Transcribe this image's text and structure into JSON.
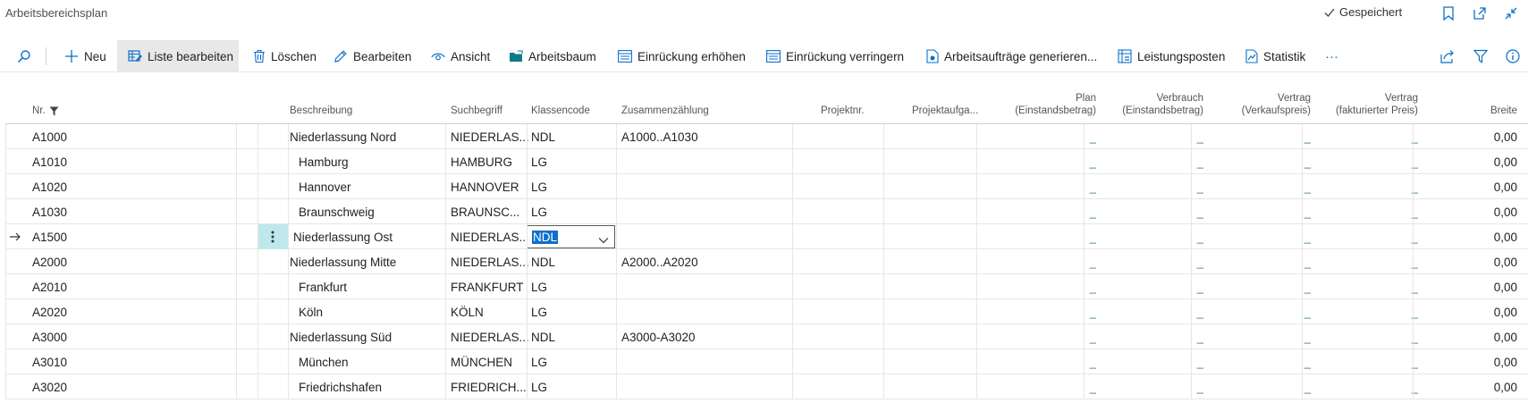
{
  "window": {
    "title": "Arbeitsbereichsplan",
    "saved_label": "Gespeichert"
  },
  "actions": {
    "new": "Neu",
    "edit_list": "Liste bearbeiten",
    "delete": "Löschen",
    "edit": "Bearbeiten",
    "view": "Ansicht",
    "job_tree": "Arbeitsbaum",
    "indent_increase": "Einrückung erhöhen",
    "indent_decrease": "Einrückung verringern",
    "generate_jobs": "Arbeitsaufträge generieren...",
    "ledger_entries": "Leistungsposten",
    "statistics": "Statistik",
    "more": "···"
  },
  "columns": {
    "no": "Nr.",
    "description": "Beschreibung",
    "search_name": "Suchbegriff",
    "class_code": "Klassencode",
    "totaling": "Zusammenzählung",
    "project_no": "Projektnr.",
    "project_task": "Projektaufga...",
    "plan_1": "Plan",
    "plan_2": "(Einstandsbetrag)",
    "usage_1": "Verbrauch",
    "usage_2": "(Einstandsbetrag)",
    "contract_1": "Vertrag",
    "contract_2": "(Verkaufspreis)",
    "invoiced_1": "Vertrag",
    "invoiced_2": "(fakturierter Preis)",
    "width": "Breite"
  },
  "rows": [
    {
      "no": "A1000",
      "description": "Niederlassung Nord",
      "search": "NIEDERLAS...",
      "class": "NDL",
      "totaling": "A1000..A1030",
      "plan": "_",
      "usage": "_",
      "contract": "_",
      "invoiced": "_",
      "width": "0,00"
    },
    {
      "no": "A1010",
      "description": "Hamburg",
      "search": "HAMBURG",
      "class": "LG",
      "totaling": "",
      "plan": "_",
      "usage": "_",
      "contract": "_",
      "invoiced": "_",
      "width": "0,00"
    },
    {
      "no": "A1020",
      "description": "Hannover",
      "search": "HANNOVER",
      "class": "LG",
      "totaling": "",
      "plan": "_",
      "usage": "_",
      "contract": "_",
      "invoiced": "_",
      "width": "0,00"
    },
    {
      "no": "A1030",
      "description": "Braunschweig",
      "search": "BRAUNSC...",
      "class": "LG",
      "totaling": "",
      "plan": "_",
      "usage": "_",
      "contract": "_",
      "invoiced": "_",
      "width": "0,00"
    },
    {
      "no": "A1500",
      "description": "Niederlassung Ost",
      "search": "NIEDERLAS...",
      "class": "NDL",
      "totaling": "",
      "plan": "_",
      "usage": "_",
      "contract": "_",
      "invoiced": "_",
      "width": "0,00"
    },
    {
      "no": "A2000",
      "description": "Niederlassung Mitte",
      "search": "NIEDERLAS...",
      "class": "NDL",
      "totaling": "A2000..A2020",
      "plan": "_",
      "usage": "_",
      "contract": "_",
      "invoiced": "_",
      "width": "0,00"
    },
    {
      "no": "A2010",
      "description": "Frankfurt",
      "search": "FRANKFURT",
      "class": "LG",
      "totaling": "",
      "plan": "_",
      "usage": "_",
      "contract": "_",
      "invoiced": "_",
      "width": "0,00"
    },
    {
      "no": "A2020",
      "description": "Köln",
      "search": "KÖLN",
      "class": "LG",
      "totaling": "",
      "plan": "_",
      "usage": "_",
      "contract": "_",
      "invoiced": "_",
      "width": "0,00"
    },
    {
      "no": "A3000",
      "description": "Niederlassung Süd",
      "search": "NIEDERLAS...",
      "class": "NDL",
      "totaling": "A3000-A3020",
      "plan": "_",
      "usage": "_",
      "contract": "_",
      "invoiced": "_",
      "width": "0,00"
    },
    {
      "no": "A3010",
      "description": "München",
      "search": "MÜNCHEN",
      "class": "LG",
      "totaling": "",
      "plan": "_",
      "usage": "_",
      "contract": "_",
      "invoiced": "_",
      "width": "0,00"
    },
    {
      "no": "A3020",
      "description": "Friedrichshafen",
      "search": "FRIEDRICH...",
      "class": "LG",
      "totaling": "",
      "plan": "_",
      "usage": "_",
      "contract": "_",
      "invoiced": "_",
      "width": "0,00"
    }
  ],
  "indented_rows": [
    1,
    2,
    3,
    6,
    7,
    9,
    10
  ],
  "selected_row": 4,
  "colors": {
    "accent": "#0d6fc9",
    "context_cell": "#bfe8ec",
    "dash": "#2b8a4e",
    "active_action": "#e8e8e8"
  }
}
